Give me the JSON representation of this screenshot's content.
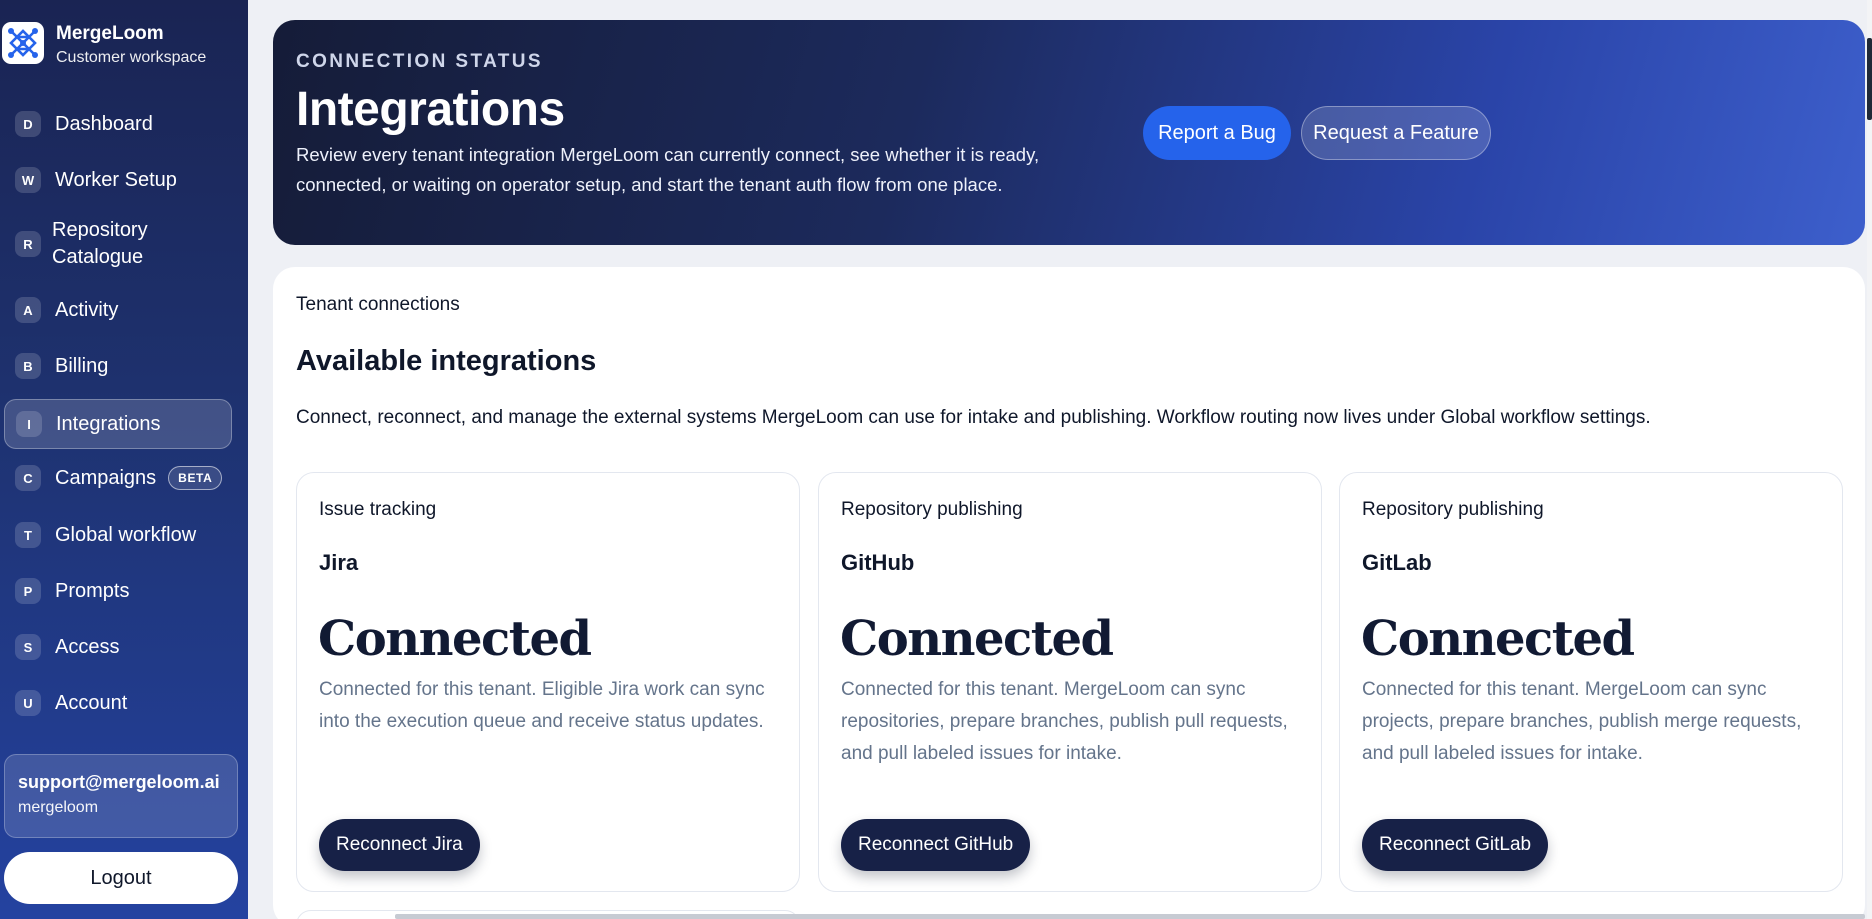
{
  "brand": {
    "name": "MergeLoom",
    "subtitle": "Customer workspace"
  },
  "sidebar": {
    "items": [
      {
        "letter": "D",
        "label": "Dashboard"
      },
      {
        "letter": "W",
        "label": "Worker Setup"
      },
      {
        "letter": "R",
        "label": "Repository Catalogue"
      },
      {
        "letter": "A",
        "label": "Activity"
      },
      {
        "letter": "B",
        "label": "Billing"
      },
      {
        "letter": "I",
        "label": "Integrations",
        "active": true
      },
      {
        "letter": "C",
        "label": "Campaigns",
        "badge": "BETA"
      },
      {
        "letter": "T",
        "label": "Global workflow"
      },
      {
        "letter": "P",
        "label": "Prompts"
      },
      {
        "letter": "S",
        "label": "Access"
      },
      {
        "letter": "U",
        "label": "Account"
      }
    ]
  },
  "user": {
    "email": "support@mergeloom.ai",
    "org": "mergeloom"
  },
  "logout_label": "Logout",
  "hero": {
    "eyebrow": "CONNECTION STATUS",
    "title": "Integrations",
    "description": "Review every tenant integration MergeLoom can currently connect, see whether it is ready, connected, or waiting on operator setup, and start the tenant auth flow from one place.",
    "report_bug_label": "Report a Bug",
    "request_feature_label": "Request a Feature"
  },
  "main": {
    "eyebrow": "Tenant connections",
    "title": "Available integrations",
    "description": "Connect, reconnect, and manage the external systems MergeLoom can use for intake and publishing. Workflow routing now lives under Global workflow settings.",
    "cards": [
      {
        "category": "Issue tracking",
        "name": "Jira",
        "status": "Connected",
        "description": "Connected for this tenant. Eligible Jira work can sync into the execution queue and receive status updates.",
        "button": "Reconnect Jira"
      },
      {
        "category": "Repository publishing",
        "name": "GitHub",
        "status": "Connected",
        "description": "Connected for this tenant. MergeLoom can sync repositories, prepare branches, publish pull requests, and pull labeled issues for intake.",
        "button": "Reconnect GitHub"
      },
      {
        "category": "Repository publishing",
        "name": "GitLab",
        "status": "Connected",
        "description": "Connected for this tenant. MergeLoom can sync projects, prepare branches, publish merge requests, and pull labeled issues for intake.",
        "button": "Reconnect GitLab"
      }
    ]
  },
  "colors": {
    "sidebar_top": "#1a2453",
    "sidebar_bottom": "#2442a0",
    "accent": "#2563eb",
    "card_button": "#172147"
  }
}
